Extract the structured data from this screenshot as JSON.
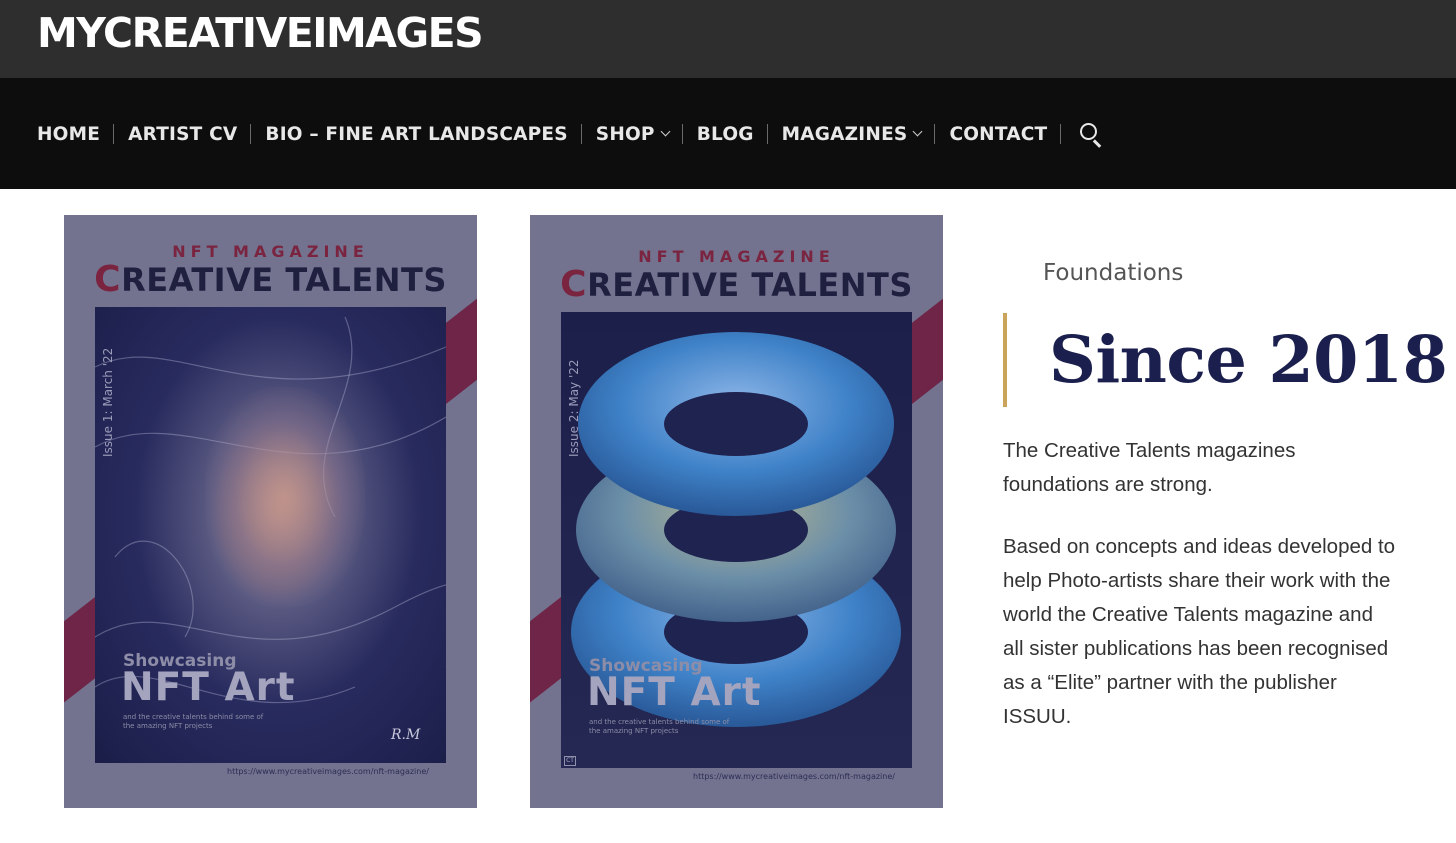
{
  "site": {
    "title": "MYCREATIVEIMAGES"
  },
  "nav": {
    "items": [
      {
        "label": "HOME"
      },
      {
        "label": "ARTIST CV"
      },
      {
        "label": "BIO – FINE ART LANDSCAPES"
      },
      {
        "label": "SHOP",
        "has_dropdown": true
      },
      {
        "label": "BLOG"
      },
      {
        "label": "MAGAZINES",
        "has_dropdown": true
      },
      {
        "label": "CONTACT"
      }
    ],
    "search_icon": "search-icon"
  },
  "covers": [
    {
      "kicker": "NFT MAGAZINE",
      "title_first": "C",
      "title_rest": "REATIVE TALENTS",
      "issue": "Issue 1: March '22",
      "showcasing": "Showcasing",
      "headline": "NFT Art",
      "subline": "and the creative talents behind some of the amazing NFT projects",
      "url": "https://www.mycreativeimages.com/nft-magazine/"
    },
    {
      "kicker": "NFT MAGAZINE",
      "title_first": "C",
      "title_rest": "REATIVE TALENTS",
      "issue": "Issue 2: May '22",
      "showcasing": "Showcasing",
      "headline": "NFT Art",
      "subline": "and the creative talents behind some of the amazing NFT projects",
      "badge": "CT",
      "url": "https://www.mycreativeimages.com/nft-magazine/"
    }
  ],
  "about": {
    "eyebrow": "Foundations",
    "heading": "Since 2018",
    "paragraph_1": "The Creative Talents magazines foundations are strong.",
    "paragraph_2": "Based on concepts and ideas developed to help Photo-artists share their work with the world the Creative Talents magazine and all sister publications has been recognised as a “Elite” partner with the publisher ISSUU."
  },
  "colors": {
    "topbar": "#2e2e2e",
    "navbar": "#0d0d0d",
    "accent_gold": "#c9a45a",
    "heading_navy": "#1b1f4d",
    "cover_frame": "#73738f",
    "cover_stripe": "#6f2547"
  }
}
